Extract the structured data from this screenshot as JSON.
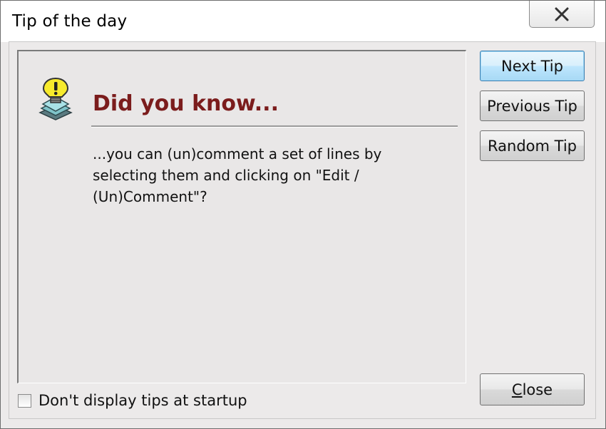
{
  "window": {
    "title": "Tip of the day",
    "close_glyph": "✕"
  },
  "tip": {
    "icon": "lightbulb-icon",
    "heading": "Did you know...",
    "text": "...you can (un)comment a set of lines by selecting them and clicking on \"Edit / (Un)Comment\"?"
  },
  "buttons": {
    "next": "Next Tip",
    "previous": "Previous Tip",
    "random": "Random Tip",
    "close_first": "C",
    "close_rest": "lose"
  },
  "startup_option": {
    "label": "Don't display tips at startup",
    "checked": false
  },
  "colors": {
    "heading": "#7b1c1c",
    "default_button_border": "#3c7fb1"
  }
}
